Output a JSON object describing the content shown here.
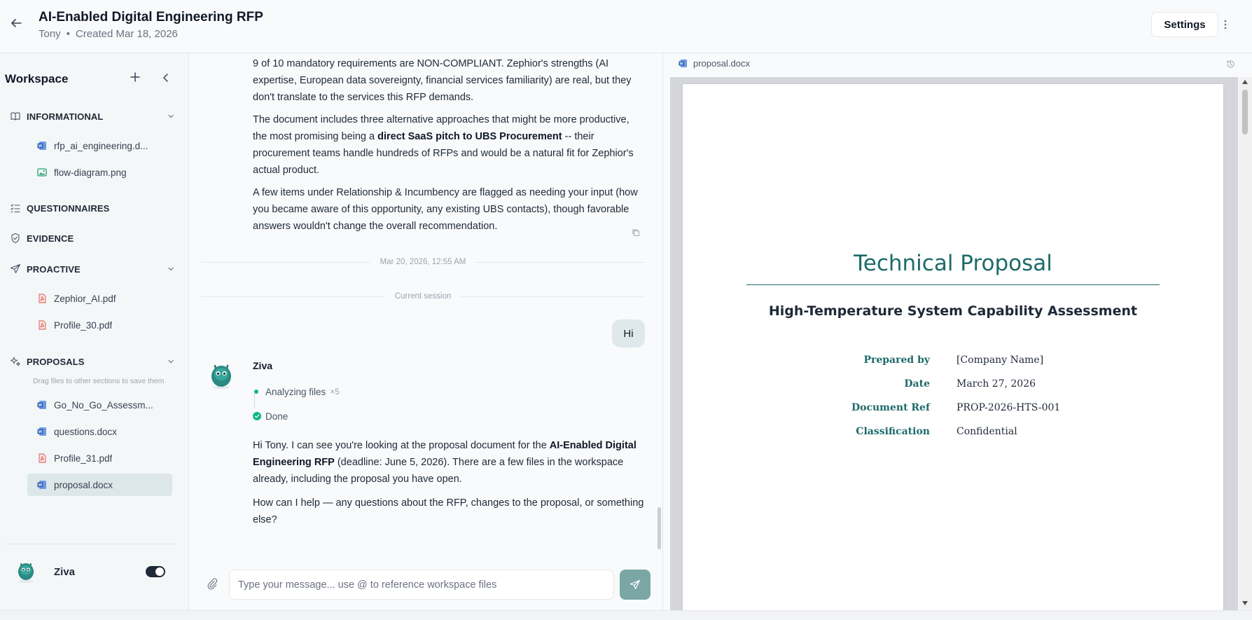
{
  "header": {
    "title": "AI-Enabled Digital Engineering RFP",
    "owner": "Tony",
    "created": "Created Mar 18, 2026",
    "settings_label": "Settings"
  },
  "sidebar": {
    "title": "Workspace",
    "sections": {
      "informational": {
        "label": "INFORMATIONAL",
        "files": [
          "rfp_ai_engineering.d...",
          "flow-diagram.png"
        ]
      },
      "questionnaires": {
        "label": "QUESTIONNAIRES"
      },
      "evidence": {
        "label": "EVIDENCE"
      },
      "proactive": {
        "label": "PROACTIVE",
        "files": [
          "Zephior_AI.pdf",
          "Profile_30.pdf"
        ]
      },
      "proposals": {
        "label": "PROPOSALS",
        "hint": "Drag files to other sections to save them",
        "files": [
          "Go_No_Go_Assessm...",
          "questions.docx",
          "Profile_31.pdf",
          "proposal.docx"
        ]
      }
    },
    "assistant_name": "Ziva"
  },
  "chat": {
    "p1": "9 of 10 mandatory requirements are NON-COMPLIANT. Zephior's strengths (AI expertise, European data sovereignty, financial services familiarity) are real, but they don't translate to the services this RFP demands.",
    "p2_a": "The document includes three alternative approaches that might be more productive, the most promising being a ",
    "p2_b": "direct SaaS pitch to UBS Procurement",
    "p2_c": " -- their procurement teams handle hundreds of RFPs and would be a natural fit for Zephior's actual product.",
    "p3": "A few items under Relationship & Incumbency are flagged as needing your input (how you became aware of this opportunity, any existing UBS contacts), though favorable answers wouldn't change the overall recommendation.",
    "timestamp": "Mar 20, 2026, 12:55 AM",
    "session_label": "Current session",
    "user_message": "Hi",
    "bot_name": "Ziva",
    "status_analyzing": "Analyzing files",
    "status_count": "×5",
    "status_done": "Done",
    "r1_a": "Hi Tony. I can see you're looking at the proposal document for the ",
    "r1_b": "AI-Enabled Digital Engineering RFP",
    "r1_c": " (deadline: June 5, 2026). There are a few files in the workspace already, including the proposal you have open.",
    "r2": "How can I help — any questions about the RFP, changes to the proposal, or something else?",
    "input_placeholder": "Type your message... use @ to reference workspace files"
  },
  "document": {
    "tab_label": "proposal.docx",
    "title": "Technical Proposal",
    "subtitle": "High-Temperature System Capability Assessment",
    "meta": [
      {
        "key": "Prepared by",
        "value": "[Company Name]"
      },
      {
        "key": "Date",
        "value": "March 27, 2026"
      },
      {
        "key": "Document Ref",
        "value": "PROP-2026-HTS-001"
      },
      {
        "key": "Classification",
        "value": "Confidential"
      }
    ]
  },
  "colors": {
    "accent": "#1e6a6a",
    "active_item": "#dde7e9",
    "send_button": "#7aa7a5",
    "status_green": "#10b981",
    "word_icon": "#2b5fb4",
    "pdf_icon": "#d9534f",
    "image_icon": "#22a06b"
  }
}
